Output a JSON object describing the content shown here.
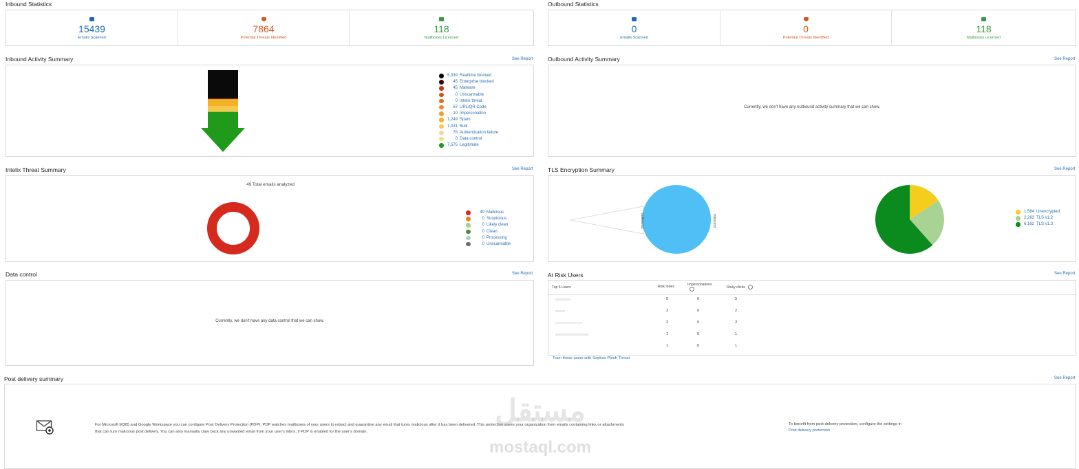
{
  "inbound_stats": {
    "title": "Inbound Statistics",
    "cards": [
      {
        "value": "15439",
        "label": "Emails Scanned"
      },
      {
        "value": "7864",
        "label": "Potential Threats Identified"
      },
      {
        "value": "118",
        "label": "Mailboxes Licensed"
      }
    ]
  },
  "outbound_stats": {
    "title": "Outbound Statistics",
    "cards": [
      {
        "value": "0",
        "label": "Emails Scanned"
      },
      {
        "value": "0",
        "label": "Potential Threats Identified"
      },
      {
        "value": "118",
        "label": "Mailboxes Licensed"
      }
    ]
  },
  "see_report": "See Report",
  "inbound_activity": {
    "title": "Inbound Activity Summary",
    "legend": [
      {
        "count": "5,339",
        "label": "Realtime blocked",
        "color": "#0a0a0a"
      },
      {
        "count": "45",
        "label": "Enterprise blocked",
        "color": "#3a0a0a"
      },
      {
        "count": "45",
        "label": "Malware",
        "color": "#c0391b"
      },
      {
        "count": "0",
        "label": "Unscannable",
        "color": "#d4541f"
      },
      {
        "count": "0",
        "label": "Intelix threat",
        "color": "#e0701f"
      },
      {
        "count": "67",
        "label": "URL/QR Code",
        "color": "#ea8a2c"
      },
      {
        "count": "10",
        "label": "Impersonation",
        "color": "#eea12e"
      },
      {
        "count": "1,249",
        "label": "Spam",
        "color": "#f2b126"
      },
      {
        "count": "1,031",
        "label": "Bulk",
        "color": "#f6c94a"
      },
      {
        "count": "78",
        "label": "Authentication failure",
        "color": "#f4d79a"
      },
      {
        "count": "0",
        "label": "Data control",
        "color": "#efe27a"
      },
      {
        "count": "7,575",
        "label": "Legitimate",
        "color": "#1f9a1a"
      }
    ]
  },
  "outbound_activity": {
    "title": "Outbound Activity Summary",
    "message": "Currently, we don't have any outbound activity summary that we can show."
  },
  "intelix": {
    "title": "Intelix Threat Summary",
    "total_text": "49 Total emails analyzed",
    "legend": [
      {
        "count": "49",
        "label": "Malicious",
        "color": "#d62a1e"
      },
      {
        "count": "0",
        "label": "Suspicious",
        "color": "#e8861f"
      },
      {
        "count": "0",
        "label": "Likely clean",
        "color": "#a8d08d"
      },
      {
        "count": "0",
        "label": "Clean",
        "color": "#4f8a3a"
      },
      {
        "count": "0",
        "label": "Processing",
        "color": "#b5d3c4"
      },
      {
        "count": "0",
        "label": "Unscannable",
        "color": "#6e6e6e"
      }
    ]
  },
  "tls": {
    "title": "TLS Encryption Summary",
    "circle_labels": [
      "outbound",
      "inbound"
    ],
    "legend": [
      {
        "count": "1,584",
        "label": "Unencrypted",
        "color": "#f4cd1e"
      },
      {
        "count": "2,263",
        "label": "TLS v1.2",
        "color": "#a9d394"
      },
      {
        "count": "6,162",
        "label": "TLS v1.3",
        "color": "#0b8a1d"
      }
    ]
  },
  "data_control": {
    "title": "Data control",
    "message": "Currently, we don't have any data control that we can show."
  },
  "at_risk": {
    "title": "At Risk Users",
    "headers": [
      "Top 5 Users",
      "Risk index",
      "Impersonations",
      "Risky clicks"
    ],
    "rows": [
      {
        "risk": "5",
        "imp": "0",
        "clicks": "5"
      },
      {
        "risk": "2",
        "imp": "0",
        "clicks": "2"
      },
      {
        "risk": "2",
        "imp": "0",
        "clicks": "2"
      },
      {
        "risk": "1",
        "imp": "0",
        "clicks": "1"
      },
      {
        "risk": "1",
        "imp": "0",
        "clicks": "1"
      }
    ],
    "train_link": "Train these users with Sophos Phish Threat"
  },
  "post_delivery": {
    "title": "Post delivery summary",
    "description": "For Microsoft M365 and Google Workspace you can configure Post Delivery Protection (PDP). PDP watches mailboxes of your users to retract and quarantine any email that turns malicious after it has been delivered. This protection saves your organization from emails containing links or attachments that can turn malicious post delivery. You can also manually claw back any unwanted email from your user's inbox, if PDP is enabled for the user's domain.",
    "side_text": "To benefit from post delivery protection, configure the settings in",
    "side_link": "Post delivery protection"
  },
  "watermark": {
    "arabic": "مستقل",
    "latin": "mostaql.com"
  },
  "chart_data": [
    {
      "type": "bar",
      "title": "Inbound Activity Summary",
      "categories": [
        "Realtime blocked",
        "Enterprise blocked",
        "Malware",
        "Unscannable",
        "Intelix threat",
        "URL/QR Code",
        "Impersonation",
        "Spam",
        "Bulk",
        "Authentication failure",
        "Data control",
        "Legitimate"
      ],
      "values": [
        5339,
        45,
        45,
        0,
        0,
        67,
        10,
        1249,
        1031,
        78,
        0,
        7575
      ]
    },
    {
      "type": "pie",
      "title": "Intelix Threat Summary",
      "categories": [
        "Malicious",
        "Suspicious",
        "Likely clean",
        "Clean",
        "Processing",
        "Unscannable"
      ],
      "values": [
        49,
        0,
        0,
        0,
        0,
        0
      ]
    },
    {
      "type": "pie",
      "title": "TLS Encryption Summary",
      "categories": [
        "Unencrypted",
        "TLS v1.2",
        "TLS v1.3"
      ],
      "values": [
        1584,
        2263,
        6162
      ]
    }
  ]
}
